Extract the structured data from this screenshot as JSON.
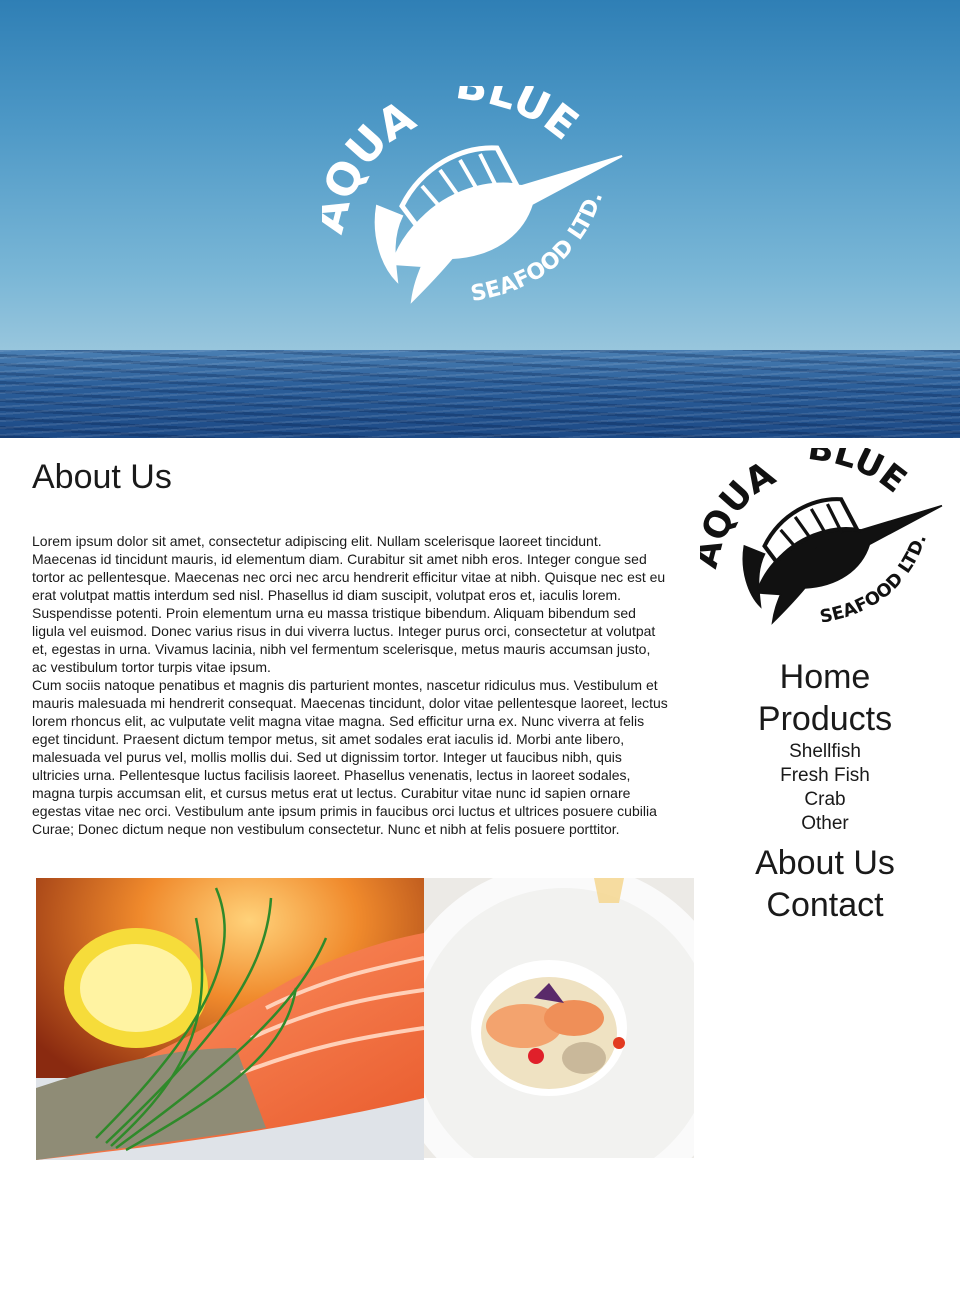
{
  "hero": {
    "logo": {
      "word1": "AQUA",
      "word2": "BLUE",
      "word3": "SEAFOOD LTD."
    }
  },
  "main": {
    "title": "About Us",
    "paragraphs": [
      "Lorem ipsum dolor sit amet, consectetur adipiscing elit. Nullam scelerisque laoreet tincidunt. Maecenas id tincidunt mauris, id elementum diam. Curabitur sit amet nibh eros. Integer congue sed tortor ac pellentesque. Maecenas nec orci nec arcu hendrerit efficitur vitae at nibh. Quisque nec est eu erat volutpat mattis interdum sed nisl. Phasellus id diam suscipit, volutpat eros et, iaculis lorem. Suspendisse potenti. Proin elementum urna eu massa tristique bibendum. Aliquam bibendum sed ligula vel euismod. Donec varius risus in dui viverra luctus. Integer purus orci, consectetur at volutpat et, egestas in urna. Vivamus lacinia, nibh vel fermentum scelerisque, metus mauris accumsan justo, ac vestibulum tortor turpis vitae ipsum.",
      "Cum sociis natoque penatibus et magnis dis parturient montes, nascetur ridiculus mus. Vestibulum et mauris malesuada mi hendrerit consequat. Maecenas tincidunt, dolor vitae pellentesque laoreet, lectus lorem rhoncus elit, ac vulputate velit magna vitae magna. Sed efficitur urna ex. Nunc viverra at felis eget tincidunt. Praesent dictum tempor metus, sit amet sodales erat iaculis id. Morbi ante libero, malesuada vel purus vel, mollis mollis dui. Sed ut dignissim tortor. Integer ut faucibus nibh, quis ultricies urna. Pellentesque luctus facilisis laoreet. Phasellus venenatis, lectus in laoreet sodales, magna turpis accumsan elit, et cursus metus erat ut lectus. Curabitur vitae nunc id sapien ornare egestas vitae nec orci. Vestibulum ante ipsum primis in faucibus orci luctus et ultrices posuere cubilia Curae; Donec dictum neque non vestibulum consectetur. Nunc et nibh at felis posuere porttitor."
    ]
  },
  "sidebar": {
    "logo": {
      "word1": "AQUA",
      "word2": "BLUE",
      "word3": "SEAFOOD LTD."
    },
    "nav": {
      "home": "Home",
      "products": "Products",
      "sub": [
        "Shellfish",
        "Fresh Fish",
        "Crab",
        "Other"
      ],
      "about": "About Us",
      "contact": "Contact"
    }
  },
  "colors": {
    "sky_top": "#2f7fb5",
    "sea": "#1c4985",
    "text": "#1a1a1a"
  }
}
